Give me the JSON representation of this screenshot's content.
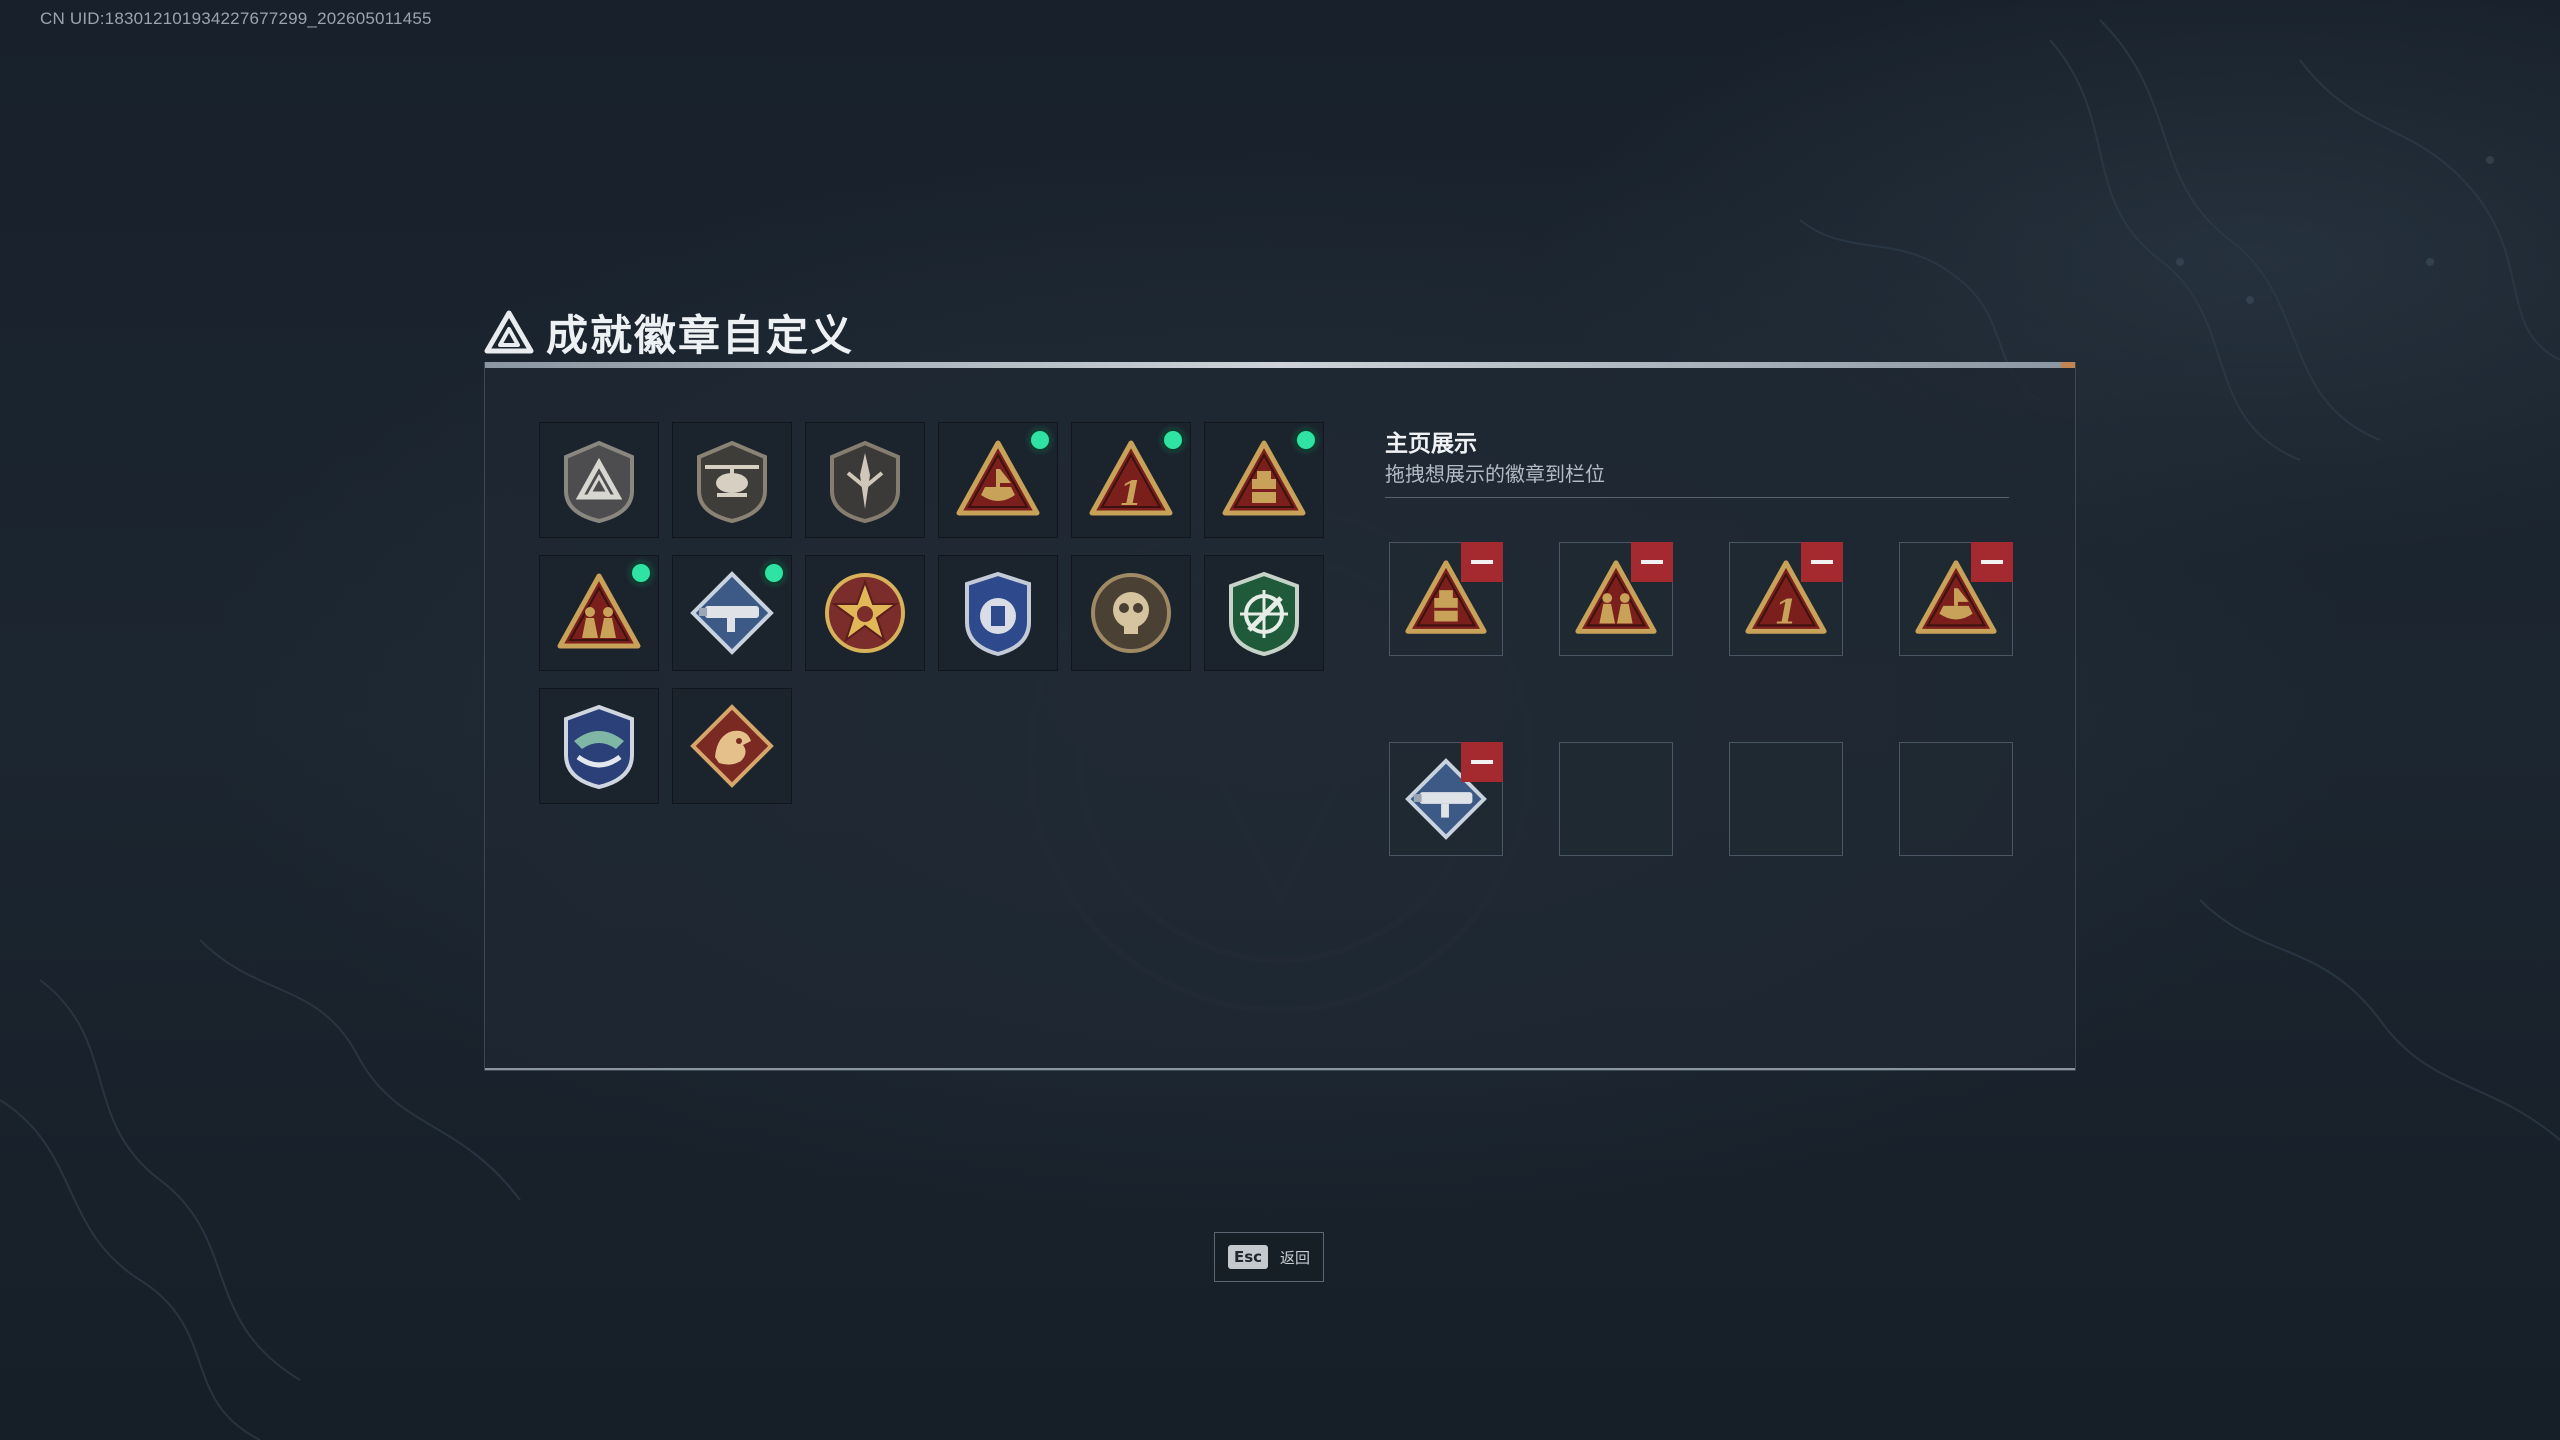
{
  "uid_text": "CN UID:18301210193422767729​9_202605011455",
  "page_title": "成就徽章自定义",
  "title_icon": "triangle-logo-icon",
  "badges": [
    {
      "icon": "shield-triangle-badge-icon",
      "new": false
    },
    {
      "icon": "helicopter-badge-icon",
      "new": false
    },
    {
      "icon": "dagger-shield-badge-icon",
      "new": false
    },
    {
      "icon": "boat-triangle-badge-icon",
      "new": true
    },
    {
      "icon": "number-one-triangle-badge-icon",
      "new": true
    },
    {
      "icon": "box-triangle-badge-icon",
      "new": true
    },
    {
      "icon": "soldiers-triangle-badge-icon",
      "new": true
    },
    {
      "icon": "rocket-launcher-diamond-badge-icon",
      "new": true
    },
    {
      "icon": "star-medal-badge-icon",
      "new": false
    },
    {
      "icon": "police-shield-badge-icon",
      "new": false
    },
    {
      "icon": "skull-round-badge-icon",
      "new": false
    },
    {
      "icon": "green-crosshair-shield-badge-icon",
      "new": false
    },
    {
      "icon": "blue-wings-shield-badge-icon",
      "new": false
    },
    {
      "icon": "dragon-diamond-badge-icon",
      "new": false
    }
  ],
  "showcase": {
    "title": "主页展示",
    "subtitle": "拖拽想展示的徽章到栏位",
    "slots": [
      {
        "icon": "box-triangle-badge-icon",
        "filled": true
      },
      {
        "icon": "soldiers-triangle-badge-icon",
        "filled": true
      },
      {
        "icon": "number-one-triangle-badge-icon",
        "filled": true
      },
      {
        "icon": "boat-triangle-badge-icon",
        "filled": true
      },
      {
        "icon": "rocket-launcher-diamond-badge-icon",
        "filled": true
      },
      {
        "icon": "",
        "filled": false
      },
      {
        "icon": "",
        "filled": false
      },
      {
        "icon": "",
        "filled": false
      }
    ]
  },
  "footer": {
    "esc_key": "Esc",
    "esc_label": "返回"
  },
  "colors": {
    "new_dot": "#2fe3a4",
    "remove_button": "#a52a30",
    "badge_gold": "#c9a25a",
    "badge_red": "#7a1f1c"
  }
}
